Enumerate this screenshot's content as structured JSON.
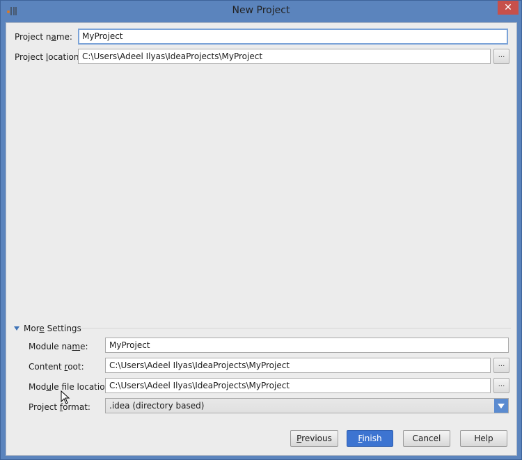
{
  "window": {
    "title": "New Project",
    "app_icon": "intellij-idea-icon",
    "close_label": "✕"
  },
  "project": {
    "name_label_pre": "Project n",
    "name_label_u": "a",
    "name_label_post": "me:",
    "name_value": "MyProject",
    "location_label_pre": "Project ",
    "location_label_u": "l",
    "location_label_post": "ocation:",
    "location_value": "C:\\Users\\Adeel Ilyas\\IdeaProjects\\MyProject",
    "browse_label": "..."
  },
  "more_settings": {
    "title_pre": "Mor",
    "title_u": "e",
    "title_post": " Settings",
    "module_name_label_pre": "Module na",
    "module_name_label_u": "m",
    "module_name_label_post": "e:",
    "module_name_value": "MyProject",
    "content_root_label_pre": "Content ",
    "content_root_label_u": "r",
    "content_root_label_post": "oot:",
    "content_root_value": "C:\\Users\\Adeel Ilyas\\IdeaProjects\\MyProject",
    "module_file_label_pre": "Mod",
    "module_file_label_u": "u",
    "module_file_label_post": "le file location:",
    "module_file_value": "C:\\Users\\Adeel Ilyas\\IdeaProjects\\MyProject",
    "format_label_pre": "Project ",
    "format_label_u": "f",
    "format_label_post": "ormat:",
    "format_value": ".idea (directory based)",
    "browse_label": "..."
  },
  "buttons": {
    "previous_u": "P",
    "previous_rest": "revious",
    "finish_u": "F",
    "finish_rest": "inish",
    "cancel": "Cancel",
    "help": "Help"
  }
}
